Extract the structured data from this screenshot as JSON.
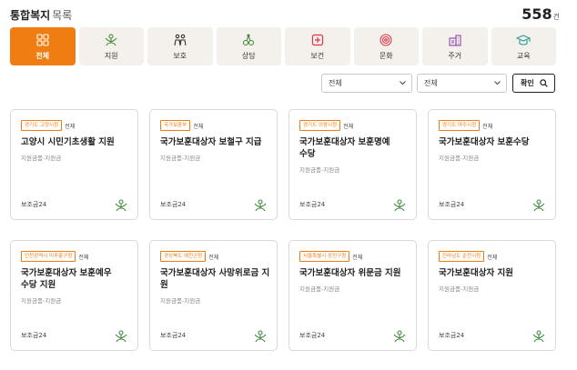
{
  "header": {
    "title": "통합복지",
    "subtitle": "목록",
    "count": "558",
    "count_unit": "건"
  },
  "categories": [
    {
      "label": "전체",
      "icon": "grid-icon",
      "active": true
    },
    {
      "label": "지원",
      "icon": "support-icon",
      "color": "#3f8a3a"
    },
    {
      "label": "보호",
      "icon": "protection-icon",
      "color": "#333333"
    },
    {
      "label": "상담",
      "icon": "counseling-icon",
      "color": "#3f8a3a"
    },
    {
      "label": "보건",
      "icon": "health-icon",
      "color": "#d9364a"
    },
    {
      "label": "문화",
      "icon": "culture-icon",
      "color": "#d9364a"
    },
    {
      "label": "주거",
      "icon": "housing-icon",
      "color": "#8e44ad"
    },
    {
      "label": "교육",
      "icon": "education-icon",
      "color": "#2a9d8f"
    }
  ],
  "filters": {
    "select1": "전체",
    "select2": "전체",
    "search_button": "확인"
  },
  "cards": [
    {
      "agency": "경기도 고양시청",
      "scope": "전체",
      "title": "고양시 시민기초생활 지원",
      "sub": "지원금품-지원금",
      "source": "보조금24"
    },
    {
      "agency": "국가보훈부",
      "scope": "전체",
      "title": "국가보훈대상자 보철구 지급",
      "sub": "지원금품-지원금",
      "source": "보조금24"
    },
    {
      "agency": "경기도 의왕시청",
      "scope": "전체",
      "title": "국가보훈대상자 보훈명예수당",
      "sub": "지원금품-지원금",
      "source": "보조금24"
    },
    {
      "agency": "경기도 여주시청",
      "scope": "전체",
      "title": "국가보훈대상자 보훈수당",
      "sub": "지원금품-지원금",
      "source": "보조금24"
    },
    {
      "agency": "인천광역시 미추홀구청",
      "scope": "전체",
      "title": "국가보훈대상자 보훈예우수당 지원",
      "sub": "지원금품-지원금",
      "source": "보조금24"
    },
    {
      "agency": "경상북도 예천군청",
      "scope": "전체",
      "title": "국가보훈대상자 사망위로금 지원",
      "sub": "지원금품-지원금",
      "source": "보조금24"
    },
    {
      "agency": "서울특별시 광진구청",
      "scope": "전체",
      "title": "국가보훈대상자 위문금 지원",
      "sub": "지원금품-지원금",
      "source": "보조금24"
    },
    {
      "agency": "전라남도 순천시청",
      "scope": "전체",
      "title": "국가보훈대상자 지원",
      "sub": "지원금품-지원금",
      "source": "보조금24"
    }
  ],
  "colors": {
    "accent": "#f07d12",
    "tile_bg": "#f4f1ec",
    "icon_green": "#3f8a3a"
  }
}
